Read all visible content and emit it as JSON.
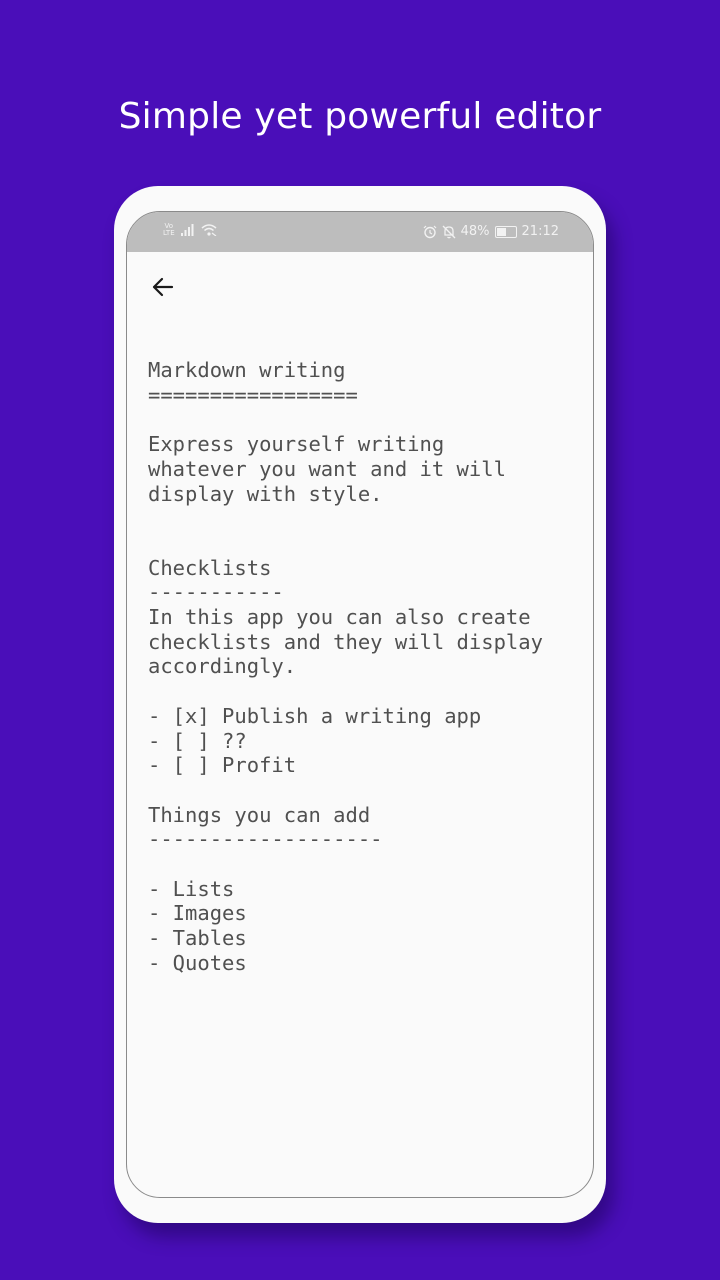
{
  "headline": "Simple yet powerful editor",
  "status_bar": {
    "network_type": "LTE",
    "battery_percent": "48%",
    "battery_level": 0.48,
    "time": "21:12",
    "icons": [
      "volte-icon",
      "signal-icon",
      "wifi-icon",
      "alarm-icon",
      "bell-off-icon",
      "battery-icon"
    ]
  },
  "toolbar": {
    "back_icon": "arrow-left-icon"
  },
  "editor": {
    "content": "Markdown writing\n=================\n\nExpress yourself writing\nwhatever you want and it will\ndisplay with style.\n\n\nChecklists\n-----------\nIn this app you can also create\nchecklists and they will display\naccordingly.\n\n- [x] Publish a writing app\n- [ ] ??\n- [ ] Profit\n\nThings you can add\n-------------------\n\n- Lists\n- Images\n- Tables\n- Quotes"
  },
  "colors": {
    "background": "#4a0eb9",
    "screen": "#fafafa",
    "status_bar": "#bdbdbd",
    "text": "#505050"
  }
}
